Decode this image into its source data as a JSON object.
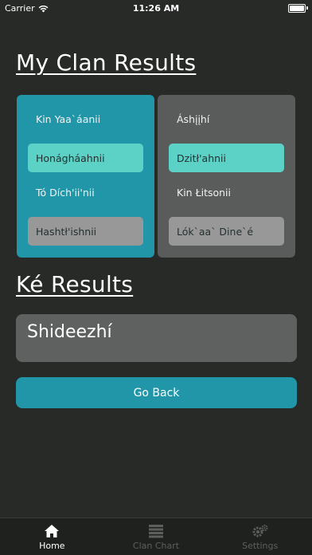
{
  "status_bar": {
    "carrier": "Carrier",
    "time": "11:26 AM"
  },
  "clan_results": {
    "title": "My Clan Results",
    "left_card": {
      "label_1": "Kin Yaa`áanii",
      "pill_1": "Honágháahnii",
      "label_2": "Tó Dích'ii'nii",
      "pill_2": "Hashtł'ishnii"
    },
    "right_card": {
      "label_1": "Áshįįhí",
      "pill_1": "Dzitł'ahnii",
      "label_2": "Kin Łitsonii",
      "pill_2": "Lók`aa` Dine`é"
    }
  },
  "ke_results": {
    "title": "Ké Results",
    "value": "Shideezhí"
  },
  "go_back_label": "Go Back",
  "tab_bar": {
    "tabs": [
      {
        "label": "Home",
        "icon": "home-icon",
        "active": true
      },
      {
        "label": "Clan Chart",
        "icon": "list-icon",
        "active": false
      },
      {
        "label": "Settings",
        "icon": "gear-icon",
        "active": false
      }
    ]
  },
  "colors": {
    "background": "#272a27",
    "accent_teal": "#2196a8",
    "pill_teal": "#5cd1c6",
    "card_gray": "#5a5b5b",
    "pill_gray": "#989898"
  }
}
